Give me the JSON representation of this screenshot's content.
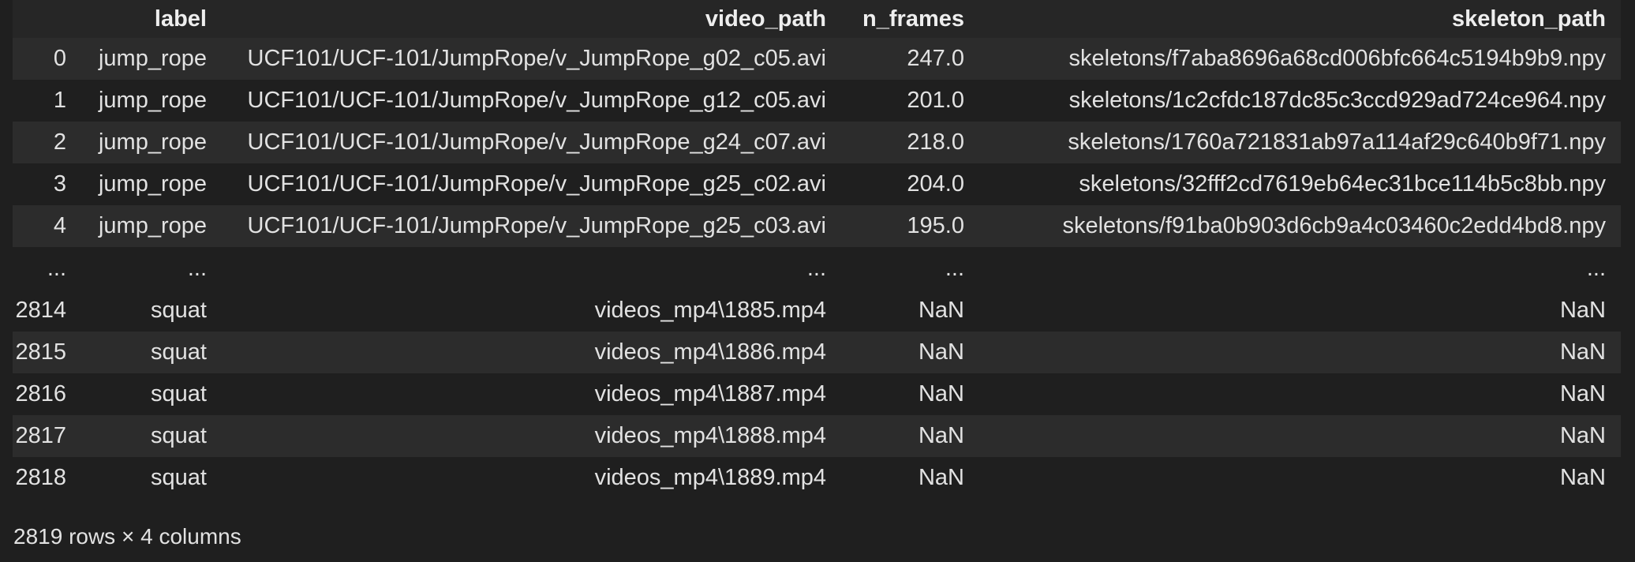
{
  "table": {
    "columns": [
      "",
      "label",
      "video_path",
      "n_frames",
      "skeleton_path"
    ],
    "rows": [
      {
        "index": "0",
        "label": "jump_rope",
        "video_path": "UCF101/UCF-101/JumpRope/v_JumpRope_g02_c05.avi",
        "n_frames": "247.0",
        "skeleton_path": "skeletons/f7aba8696a68cd006bfc664c5194b9b9.npy"
      },
      {
        "index": "1",
        "label": "jump_rope",
        "video_path": "UCF101/UCF-101/JumpRope/v_JumpRope_g12_c05.avi",
        "n_frames": "201.0",
        "skeleton_path": "skeletons/1c2cfdc187dc85c3ccd929ad724ce964.npy"
      },
      {
        "index": "2",
        "label": "jump_rope",
        "video_path": "UCF101/UCF-101/JumpRope/v_JumpRope_g24_c07.avi",
        "n_frames": "218.0",
        "skeleton_path": "skeletons/1760a721831ab97a114af29c640b9f71.npy"
      },
      {
        "index": "3",
        "label": "jump_rope",
        "video_path": "UCF101/UCF-101/JumpRope/v_JumpRope_g25_c02.avi",
        "n_frames": "204.0",
        "skeleton_path": "skeletons/32fff2cd7619eb64ec31bce114b5c8bb.npy"
      },
      {
        "index": "4",
        "label": "jump_rope",
        "video_path": "UCF101/UCF-101/JumpRope/v_JumpRope_g25_c03.avi",
        "n_frames": "195.0",
        "skeleton_path": "skeletons/f91ba0b903d6cb9a4c03460c2edd4bd8.npy"
      },
      {
        "index": "...",
        "label": "...",
        "video_path": "...",
        "n_frames": "...",
        "skeleton_path": "..."
      },
      {
        "index": "2814",
        "label": "squat",
        "video_path": "videos_mp4\\1885.mp4",
        "n_frames": "NaN",
        "skeleton_path": "NaN"
      },
      {
        "index": "2815",
        "label": "squat",
        "video_path": "videos_mp4\\1886.mp4",
        "n_frames": "NaN",
        "skeleton_path": "NaN"
      },
      {
        "index": "2816",
        "label": "squat",
        "video_path": "videos_mp4\\1887.mp4",
        "n_frames": "NaN",
        "skeleton_path": "NaN"
      },
      {
        "index": "2817",
        "label": "squat",
        "video_path": "videos_mp4\\1888.mp4",
        "n_frames": "NaN",
        "skeleton_path": "NaN"
      },
      {
        "index": "2818",
        "label": "squat",
        "video_path": "videos_mp4\\1889.mp4",
        "n_frames": "NaN",
        "skeleton_path": "NaN"
      }
    ]
  },
  "footer": {
    "shape_text": "2819 rows × 4 columns"
  },
  "colors": {
    "background": "#1f1f1f",
    "header_background": "#262626",
    "stripe_background": "#2c2c2c",
    "text": "#e2e2e2"
  }
}
